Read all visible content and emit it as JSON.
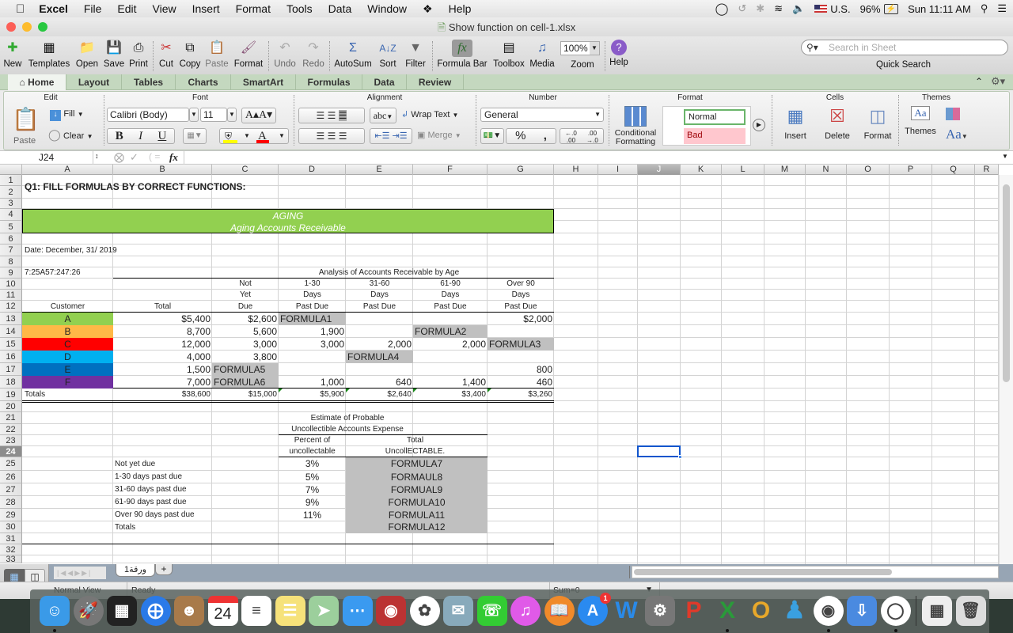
{
  "menubar": {
    "app": "Excel",
    "items": [
      "File",
      "Edit",
      "View",
      "Insert",
      "Format",
      "Tools",
      "Data",
      "Window",
      "Help"
    ],
    "status": {
      "keyboard": "U.S.",
      "battery": "96%",
      "clock": "Sun 11:11 AM"
    }
  },
  "window": {
    "title": "Show function on cell-1.xlsx"
  },
  "toolbar": {
    "buttons": [
      {
        "label": "New",
        "icon": "new-doc-icon"
      },
      {
        "label": "Templates",
        "icon": "templates-icon"
      },
      {
        "label": "Open",
        "icon": "open-folder-icon"
      },
      {
        "label": "Save",
        "icon": "save-icon"
      },
      {
        "label": "Print",
        "icon": "print-icon"
      },
      {
        "label": "Cut",
        "icon": "scissors-icon"
      },
      {
        "label": "Copy",
        "icon": "copy-icon"
      },
      {
        "label": "Paste",
        "icon": "paste-icon"
      },
      {
        "label": "Format",
        "icon": "paintbrush-icon"
      },
      {
        "label": "Undo",
        "icon": "undo-icon"
      },
      {
        "label": "Redo",
        "icon": "redo-icon"
      },
      {
        "label": "AutoSum",
        "icon": "sigma-icon"
      },
      {
        "label": "Sort",
        "icon": "sort-icon"
      },
      {
        "label": "Filter",
        "icon": "filter-icon"
      },
      {
        "label": "Formula Bar",
        "icon": "fx-icon"
      },
      {
        "label": "Toolbox",
        "icon": "toolbox-icon"
      },
      {
        "label": "Media",
        "icon": "media-icon"
      },
      {
        "label": "Zoom",
        "icon": "zoom-icon"
      },
      {
        "label": "Help",
        "icon": "help-icon"
      }
    ],
    "zoom_value": "100%",
    "search_placeholder": "Search in Sheet",
    "quick_search_label": "Quick Search"
  },
  "ribbon_tabs": [
    "Home",
    "Layout",
    "Tables",
    "Charts",
    "SmartArt",
    "Formulas",
    "Data",
    "Review"
  ],
  "ribbon": {
    "groups": {
      "edit": "Edit",
      "font": "Font",
      "alignment": "Alignment",
      "number": "Number",
      "format": "Format",
      "cells": "Cells",
      "themes": "Themes"
    },
    "paste": "Paste",
    "fill": "Fill",
    "clear": "Clear",
    "font_name": "Calibri (Body)",
    "font_size": "11",
    "bold": "B",
    "italic": "I",
    "underline": "U",
    "wrap_text": "Wrap Text",
    "merge": "Merge",
    "abc": "abc",
    "number_format": "General",
    "percent": "%",
    "comma": ",",
    "conditional_formatting": "Conditional Formatting",
    "style_normal": "Normal",
    "style_bad": "Bad",
    "insert": "Insert",
    "delete": "Delete",
    "format": "Format",
    "themes": "Themes",
    "aa": "Aa",
    "fill_color": "#ffff00",
    "font_color": "#ff0000"
  },
  "formula_bar": {
    "name_box": "J24",
    "fx": "fx",
    "content": ""
  },
  "columns": [
    "A",
    "B",
    "C",
    "D",
    "E",
    "F",
    "G",
    "H",
    "I",
    "J",
    "K",
    "L",
    "M",
    "N",
    "O",
    "P",
    "Q",
    "R"
  ],
  "selected_cell": "J24",
  "sheet": {
    "title": "Q1: FILL FORMULAS BY CORRECT FUNCTIONS:",
    "banner_line1": "AGING",
    "banner_line2": "Aging Accounts Receivable",
    "banner_color": "#92d050",
    "date": "Date: December, 31/ 2019",
    "code": "7:25A57:247:26",
    "analysis_title": "Analysis of Accounts Receivable by Age",
    "headers": {
      "customer": "Customer",
      "total": "Total",
      "not_yet_due": [
        "Not",
        "Yet",
        "Due"
      ],
      "d1_30": [
        "1-30",
        "Days",
        "Past Due"
      ],
      "d31_60": [
        "31-60",
        "Days",
        "Past Due"
      ],
      "d61_90": [
        "61-90",
        "Days",
        "Past Due"
      ],
      "over90": [
        "Over 90",
        "Days",
        "Past Due"
      ]
    },
    "rows": [
      {
        "customer": "A",
        "color": "#92d050",
        "total": "$5,400",
        "not_yet_due": "$2,600",
        "d1_30": "FORMULA1",
        "d31_60": "",
        "d61_90": "",
        "over90": "$2,000"
      },
      {
        "customer": "B",
        "color": "#ffb947",
        "total": "8,700",
        "not_yet_due": "5,600",
        "d1_30": "1,900",
        "d31_60": "",
        "d61_90": "FORMULA2",
        "over90": ""
      },
      {
        "customer": "C",
        "color": "#ff0000",
        "total": "12,000",
        "not_yet_due": "3,000",
        "d1_30": "3,000",
        "d31_60": "2,000",
        "d61_90": "2,000",
        "over90": "FORMULA3"
      },
      {
        "customer": "D",
        "color": "#00b0f0",
        "total": "4,000",
        "not_yet_due": "3,800",
        "d1_30": "",
        "d31_60": "FORMULA4",
        "d61_90": "",
        "over90": ""
      },
      {
        "customer": "E",
        "color": "#0070c0",
        "total": "1,500",
        "not_yet_due": "FORMULA5",
        "d1_30": "",
        "d31_60": "",
        "d61_90": "",
        "over90": "800"
      },
      {
        "customer": "F",
        "color": "#7030a0",
        "total": "7,000",
        "not_yet_due": "FORMULA6",
        "d1_30": "1,000",
        "d31_60": "640",
        "d61_90": "1,400",
        "over90": "460"
      }
    ],
    "totals": {
      "label": "Totals",
      "total": "$38,600",
      "not_yet_due": "$15,000",
      "d1_30": "$5,900",
      "d31_60": "$2,640",
      "d61_90": "$3,400",
      "over90": "$3,260"
    },
    "estimate": {
      "title1": "Estimate of Probable",
      "title2": "Uncollectible Accounts Expense",
      "col1": [
        "Percent of",
        "uncollectable"
      ],
      "col2": [
        "Total",
        "UncollECTABLE."
      ],
      "rows": [
        {
          "label": "Not yet due",
          "pct": "3%",
          "formula": "FORMULA7"
        },
        {
          "label": "1-30 days past due",
          "pct": "5%",
          "formula": "FORMAUL8"
        },
        {
          "label": "31-60 days past due",
          "pct": "7%",
          "formula": "FORMUAL9"
        },
        {
          "label": "61-90 days past due",
          "pct": "9%",
          "formula": "FORMULA10"
        },
        {
          "label": "Over 90 days past due",
          "pct": "11%",
          "formula": "FORMULA11"
        },
        {
          "label": "Totals",
          "pct": "",
          "formula": "FORMULA12"
        }
      ]
    }
  },
  "sheet_tabs": [
    "ورقة1"
  ],
  "status": {
    "view": "Normal View",
    "state": "Ready",
    "sum": "Sum=0"
  },
  "dock": [
    "Finder",
    "Launchpad",
    "Mission Control",
    "Safari",
    "Contacts",
    "Calendar",
    "Reminders",
    "Notes",
    "Maps",
    "Messages",
    "Photo Booth",
    "Photos",
    "Mail",
    "FaceTime",
    "iTunes",
    "iBooks",
    "App Store",
    "Word",
    "System Preferences",
    "PowerPoint",
    "Excel",
    "Outlook",
    "Messenger",
    "Chrome",
    "Downloader",
    "Webex",
    "Excel Document",
    "Trash"
  ],
  "dock_calendar_day": "24",
  "dock_appstore_badge": "1"
}
